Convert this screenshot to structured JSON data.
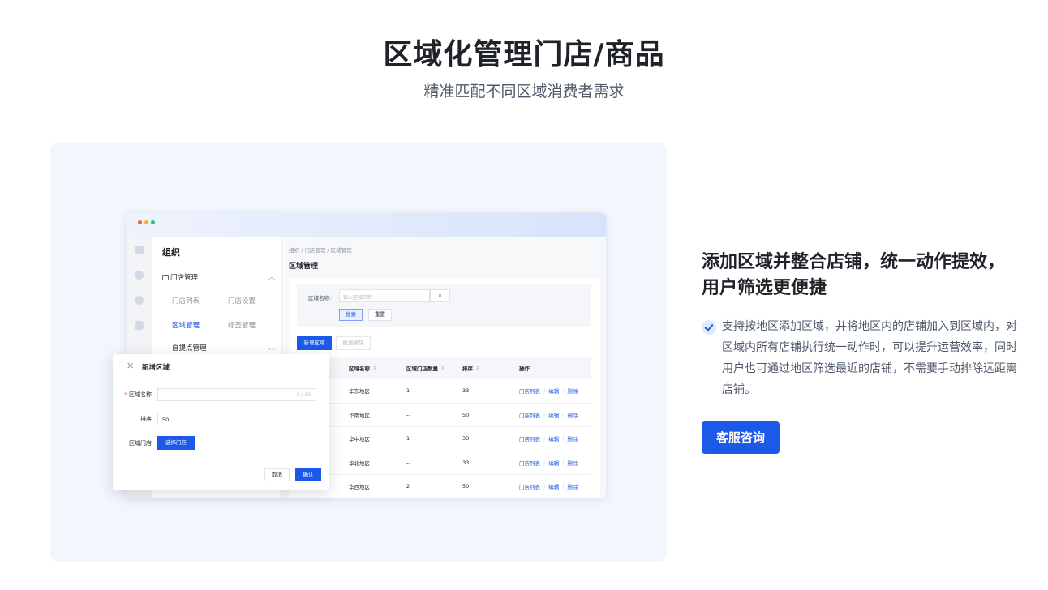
{
  "header": {
    "title": "区域化管理门店/商品",
    "subtitle": "精准匹配不同区域消费者需求"
  },
  "app": {
    "sidebar": {
      "title": "组织",
      "groups": [
        {
          "label": "门店管理",
          "items": [
            "门店列表",
            "门店设置",
            "区域管理",
            "标签管理"
          ]
        },
        {
          "label": "自提点管理"
        }
      ],
      "active_item": "区域管理"
    },
    "breadcrumb": "组织 / 门店管理 / 区域管理",
    "page_title": "区域管理",
    "search": {
      "label": "区域名称:",
      "placeholder": "输入区域名称",
      "search_button": "搜索",
      "reset_button": "重置"
    },
    "toolbar": {
      "new_button": "新增区域",
      "batch_delete_button": "批量删除"
    },
    "table": {
      "columns": [
        "区域名称",
        "区域门店数量",
        "排序",
        "操作"
      ],
      "rows": [
        {
          "name": "华东地区",
          "count": "1",
          "sort": "33"
        },
        {
          "name": "华南地区",
          "count": "--",
          "sort": "50"
        },
        {
          "name": "华中地区",
          "count": "1",
          "sort": "33"
        },
        {
          "name": "华北地区",
          "count": "--",
          "sort": "33"
        },
        {
          "name": "华西地区",
          "count": "2",
          "sort": "50"
        }
      ],
      "actions": [
        "门店列表",
        "编辑",
        "删除"
      ]
    },
    "dialog": {
      "title": "新增区域",
      "name_label": "区域名称",
      "name_counter": "0 / 30",
      "sort_label": "排序",
      "sort_value": "50",
      "store_label": "区域门店",
      "choose_button": "选择门店",
      "cancel_button": "取消",
      "confirm_button": "确认"
    }
  },
  "feature": {
    "title": "添加区域并整合店铺，统一动作提效，用户筛选更便捷",
    "description": "支持按地区添加区域，并将地区内的店铺加入到区域内，对区域内所有店铺执行统一动作时，可以提升运营效率，同时用户也可通过地区筛选最近的店铺，不需要手动排除远距离店铺。",
    "cta": "客服咨询"
  },
  "colors": {
    "primary": "#1d59e8",
    "panel_background": "#f3f6fc"
  }
}
